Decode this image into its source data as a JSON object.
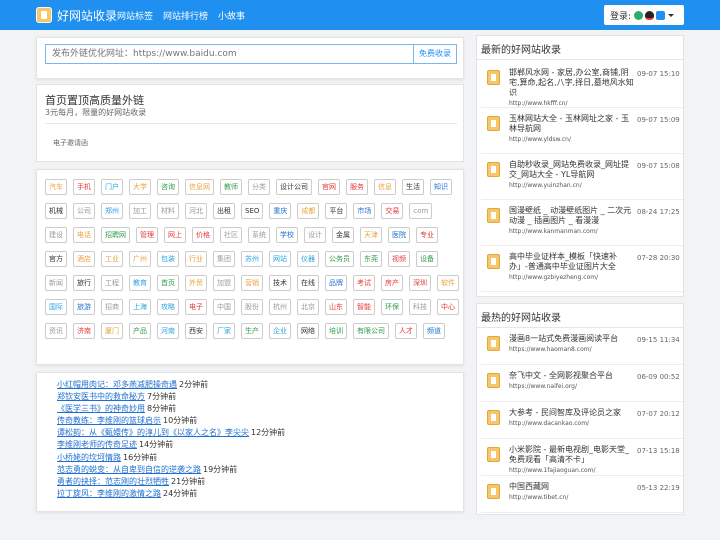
{
  "header": {
    "logo_text": "好网站收录",
    "nav": [
      "网站标签",
      "网站排行榜",
      "小故事"
    ],
    "login_label": "登录:"
  },
  "search": {
    "placeholder": "发布外链优化网址：https://www.baidu.com",
    "button_label": "免费收录"
  },
  "promo": {
    "title": "首页置顶高质量外链",
    "subtitle": "3元每月，限量的好网站收录",
    "link": "电子邀请函"
  },
  "tags": [
    {
      "label": "汽车",
      "color": "#e8a33a"
    },
    {
      "label": "手机",
      "color": "#e53935"
    },
    {
      "label": "门户",
      "color": "#29a3e0"
    },
    {
      "label": "大学",
      "color": "#e8a33a"
    },
    {
      "label": "咨询",
      "color": "#2e9d4b"
    },
    {
      "label": "信息网",
      "color": "#e8a33a"
    },
    {
      "label": "教师",
      "color": "#2e9d4b"
    },
    {
      "label": "分类",
      "color": "#999999"
    },
    {
      "label": "设计公司",
      "color": "#333333"
    },
    {
      "label": "官网",
      "color": "#e53935"
    },
    {
      "label": "服务",
      "color": "#e53935"
    },
    {
      "label": "信息",
      "color": "#e8a33a"
    },
    {
      "label": "生活",
      "color": "#333333"
    },
    {
      "label": "知识",
      "color": "#1f6fd0"
    },
    {
      "label": "机械",
      "color": "#333333"
    },
    {
      "label": "公司",
      "color": "#999999"
    },
    {
      "label": "郑州",
      "color": "#29a3e0"
    },
    {
      "label": "加工",
      "color": "#999999"
    },
    {
      "label": "材料",
      "color": "#999999"
    },
    {
      "label": "河北",
      "color": "#999999"
    },
    {
      "label": "出租",
      "color": "#333333"
    },
    {
      "label": "SEO",
      "color": "#333333"
    },
    {
      "label": "重庆",
      "color": "#1f6fd0"
    },
    {
      "label": "成都",
      "color": "#e8a33a"
    },
    {
      "label": "平台",
      "color": "#333333"
    },
    {
      "label": "市场",
      "color": "#1f6fd0"
    },
    {
      "label": "交易",
      "color": "#e53935"
    },
    {
      "label": "com",
      "color": "#999999"
    },
    {
      "label": "建设",
      "color": "#999999"
    },
    {
      "label": "电话",
      "color": "#e8a33a"
    },
    {
      "label": "招聘网",
      "color": "#2e9d4b"
    },
    {
      "label": "管理",
      "color": "#e53935"
    },
    {
      "label": "网上",
      "color": "#e53935"
    },
    {
      "label": "价格",
      "color": "#e53935"
    },
    {
      "label": "社区",
      "color": "#999999"
    },
    {
      "label": "系统",
      "color": "#999999"
    },
    {
      "label": "学校",
      "color": "#1f6fd0"
    },
    {
      "label": "设计",
      "color": "#999999"
    },
    {
      "label": "金属",
      "color": "#333333"
    },
    {
      "label": "天津",
      "color": "#e8a33a"
    },
    {
      "label": "医院",
      "color": "#1f6fd0"
    },
    {
      "label": "专业",
      "color": "#e53935"
    },
    {
      "label": "官方",
      "color": "#333333"
    },
    {
      "label": "酒店",
      "color": "#e8a33a"
    },
    {
      "label": "工业",
      "color": "#e8a33a"
    },
    {
      "label": "广州",
      "color": "#e8a33a"
    },
    {
      "label": "包装",
      "color": "#29a3e0"
    },
    {
      "label": "行业",
      "color": "#e8a33a"
    },
    {
      "label": "集团",
      "color": "#999999"
    },
    {
      "label": "苏州",
      "color": "#29a3e0"
    },
    {
      "label": "网站",
      "color": "#29a3e0"
    },
    {
      "label": "仪器",
      "color": "#29a3e0"
    },
    {
      "label": "公务员",
      "color": "#2e9d4b"
    },
    {
      "label": "东莞",
      "color": "#2e9d4b"
    },
    {
      "label": "视频",
      "color": "#e53935"
    },
    {
      "label": "设备",
      "color": "#2e9d4b"
    },
    {
      "label": "新闻",
      "color": "#999999"
    },
    {
      "label": "旅行",
      "color": "#333333"
    },
    {
      "label": "工程",
      "color": "#999999"
    },
    {
      "label": "教育",
      "color": "#29a3e0"
    },
    {
      "label": "首页",
      "color": "#2e9d4b"
    },
    {
      "label": "外贸",
      "color": "#e8a33a"
    },
    {
      "label": "加盟",
      "color": "#999999"
    },
    {
      "label": "营销",
      "color": "#e8a33a"
    },
    {
      "label": "技术",
      "color": "#333333"
    },
    {
      "label": "在线",
      "color": "#333333"
    },
    {
      "label": "品牌",
      "color": "#1f6fd0"
    },
    {
      "label": "考试",
      "color": "#e53935"
    },
    {
      "label": "房产",
      "color": "#e53935"
    },
    {
      "label": "深圳",
      "color": "#e53935"
    },
    {
      "label": "软件",
      "color": "#e8a33a"
    },
    {
      "label": "国际",
      "color": "#29a3e0"
    },
    {
      "label": "旅游",
      "color": "#1f6fd0"
    },
    {
      "label": "招商",
      "color": "#999999"
    },
    {
      "label": "上海",
      "color": "#29a3e0"
    },
    {
      "label": "攻略",
      "color": "#29a3e0"
    },
    {
      "label": "电子",
      "color": "#e53935"
    },
    {
      "label": "中国",
      "color": "#999999"
    },
    {
      "label": "股份",
      "color": "#999999"
    },
    {
      "label": "杭州",
      "color": "#999999"
    },
    {
      "label": "北京",
      "color": "#999999"
    },
    {
      "label": "山东",
      "color": "#e53935"
    },
    {
      "label": "智能",
      "color": "#e53935"
    },
    {
      "label": "环保",
      "color": "#2e9d4b"
    },
    {
      "label": "科技",
      "color": "#999999"
    },
    {
      "label": "中心",
      "color": "#e53935"
    },
    {
      "label": "资讯",
      "color": "#999999"
    },
    {
      "label": "济南",
      "color": "#e53935"
    },
    {
      "label": "厦门",
      "color": "#e8a33a"
    },
    {
      "label": "产品",
      "color": "#2e9d4b"
    },
    {
      "label": "河南",
      "color": "#29a3e0"
    },
    {
      "label": "西安",
      "color": "#333333"
    },
    {
      "label": "厂家",
      "color": "#29a3e0"
    },
    {
      "label": "生产",
      "color": "#2e9d4b"
    },
    {
      "label": "企业",
      "color": "#29a3e0"
    },
    {
      "label": "网络",
      "color": "#333333"
    },
    {
      "label": "培训",
      "color": "#2e9d4b"
    },
    {
      "label": "有限公司",
      "color": "#2e9d4b"
    },
    {
      "label": "人才",
      "color": "#e53935"
    },
    {
      "label": "频道",
      "color": "#1f6fd0"
    }
  ],
  "news": [
    {
      "title": "小红帽用肉记：邓多燕减肥操奇遇",
      "ago": "2分钟前"
    },
    {
      "title": "郑钦安医书中的救命秘方",
      "ago": "7分钟前"
    },
    {
      "title": "《医学三书》的神奇妙用",
      "ago": "8分钟前"
    },
    {
      "title": "传奇教练：李维刚的篮球启示",
      "ago": "10分钟前"
    },
    {
      "title": "谭松韵：从《甄嬛传》的淳儿到《以家人之名》李尖尖",
      "ago": "12分钟前"
    },
    {
      "title": "李维刚老师的传奇足迹",
      "ago": "14分钟前"
    },
    {
      "title": "小桥姥的坎坷情路",
      "ago": "16分钟前"
    },
    {
      "title": "范志勇的蜕变：从自卑到自信的逆袭之路",
      "ago": "19分钟前"
    },
    {
      "title": "勇者的抉择：范志刚的壮烈牺牲",
      "ago": "21分钟前"
    },
    {
      "title": "拉丁旋风：李维刚的激情之路",
      "ago": "24分钟前"
    }
  ],
  "latest": {
    "title": "最新的好网站收录",
    "items": [
      {
        "name": "邯郸风水网 - 家居,办公室,商铺,阴宅,算命,起名,八字,择日,墓地风水知识",
        "date": "09-07 15:10",
        "url": "http://www.hkfff.cn/"
      },
      {
        "name": "玉林网站大全 - 玉林网址之家 - 玉林导航网",
        "date": "09-07 15:09",
        "url": "http://www.yldsw.cn/"
      },
      {
        "name": "自助秒收录_网站免费收录_网址提交_网站大全 - YL导航网",
        "date": "09-07 15:08",
        "url": "http://www.yuinzhan.cn/"
      },
      {
        "name": "国漫壁纸 _ 动漫壁纸图片 _ 二次元动漫 _ 插画图片 _ 看漫漫",
        "date": "08-24 17:25",
        "url": "http://www.kanmanman.com/"
      },
      {
        "name": "高中毕业证样本_模板「快速补办」-普通高中毕业证图片大全",
        "date": "07-28 20:30",
        "url": "http://www.gzbiyezheng.com/"
      }
    ]
  },
  "hot": {
    "title": "最热的好网站收录",
    "items": [
      {
        "name": "漫画8一站式免费漫画阅读平台",
        "date": "09-15 11:34",
        "url": "https://www.haoman8.com/"
      },
      {
        "name": "奈飞中文 - 全网影视聚合平台",
        "date": "06-09 00:52",
        "url": "https://www.naifei.org/"
      },
      {
        "name": "大参考 - 民间智库及评论员之家",
        "date": "07-07 20:12",
        "url": "http://www.dacankao.com/"
      },
      {
        "name": "小米影院 - 最新电视剧_电影天堂_免费观看「高清不卡」",
        "date": "07-13 15:18",
        "url": "http://www.1fajiaoguan.com/"
      },
      {
        "name": "中国西藏网",
        "date": "05-13 22:19",
        "url": "http://www.tibet.cn/"
      }
    ]
  }
}
